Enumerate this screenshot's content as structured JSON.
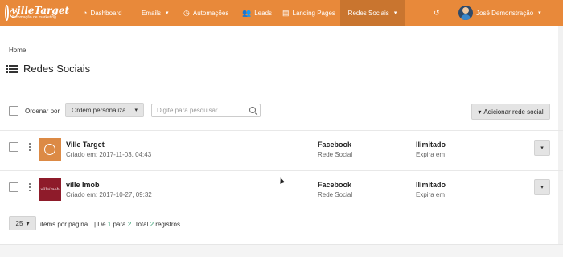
{
  "navbar": {
    "logo_brand": "villeTarget",
    "logo_tag": "Automação de marketing",
    "items": [
      {
        "label": "Dashboard",
        "icon": "dashboard-icon"
      },
      {
        "label": "Emails",
        "icon": "email-icon",
        "has_caret": true
      },
      {
        "label": "Automações",
        "icon": "clock-icon"
      },
      {
        "label": "Leads",
        "icon": "users-icon"
      },
      {
        "label": "Landing Pages",
        "icon": "page-icon"
      },
      {
        "label": "Redes Sociais",
        "icon": "",
        "has_caret": true,
        "active": true
      }
    ],
    "history_icon": "history-icon",
    "user_name": "José Demonstração",
    "accent_color": "#e8893a"
  },
  "breadcrumb": "Home",
  "page_title": "Redes Sociais",
  "toolbar": {
    "order_label": "Ordenar por",
    "order_value": "Ordem personaliza...",
    "search_placeholder": "Digite para pesquisar",
    "add_button": "Adicionar rede social"
  },
  "rows": [
    {
      "name": "Ville Target",
      "created": "Criado em: 2017-11-03, 04:43",
      "network": "Facebook",
      "network_sub": "Rede Social",
      "limit": "Ilimitado",
      "limit_sub": "Expira em"
    },
    {
      "name": "ville Imob",
      "created": "Criado em: 2017-10-27, 09:32",
      "network": "Facebook",
      "network_sub": "Rede Social",
      "limit": "Ilimitado",
      "limit_sub": "Expira em",
      "thumb_text": "villeimob"
    }
  ],
  "pagination": {
    "per_page": "25",
    "per_page_label": "items por página",
    "text_prefix": "| De",
    "from": "1",
    "to_word": "para",
    "to": "2",
    "total_word": ". Total",
    "total": "2",
    "registros": "registros"
  }
}
